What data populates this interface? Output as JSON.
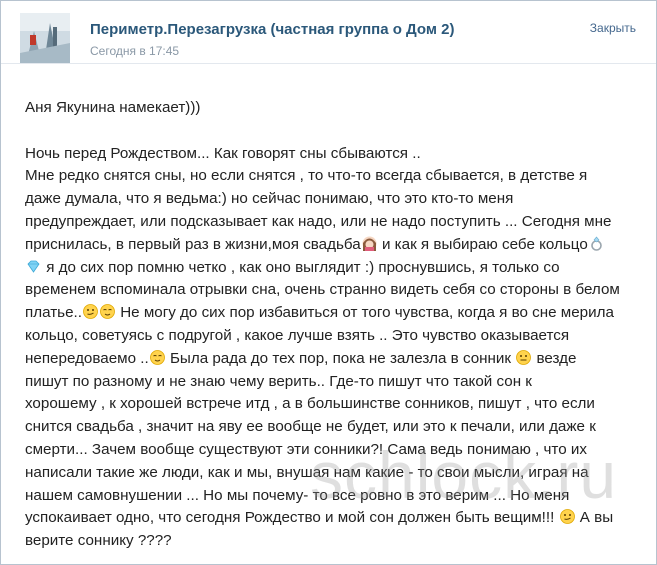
{
  "header": {
    "group_name": "Периметр.Перезагрузка (частная группа о Дом 2)",
    "post_time": "Сегодня в 17:45",
    "close_label": "Закрыть"
  },
  "post": {
    "intro": "Аня Якунина намекает)))",
    "lines": [
      "Ночь перед Рождеством... Как говорят сны сбываются ..",
      "Мне редко снятся сны, но если снятся , то что-то всегда сбывается, в детстве я",
      "даже думала, что я ведьма:) но сейчас понимаю, что это кто-то меня",
      "предупреждает, или подсказывает как надо, или не надо поступить ... Сегодня мне",
      "приснилась, в первый раз в жизни,моя свадьба",
      "и как я выбираю себе кольцо",
      "я до сих пор помню четко , как оно выглядит :) проснувшись, я только со",
      "временем вспоминала отрывки сна, очень странно видеть себя со стороны в белом",
      "платье..",
      "Не могу до сих пор избавиться от того чувства, когда я во сне мерила",
      "кольцо, советуясь с подругой , какое лучше взять .. Это чувство оказывается",
      "непередоваемо ..",
      "Была рада до тех пор, пока не залезла в сонник",
      "везде",
      "пишут по разному и не знаю чему верить.. Где-то пишут что такой сон к",
      "хорошему , к хорошей встрече итд , а в большинстве сонников, пишут , что если",
      "снится свадьба , значит на яву ее вообще не будет, или это к печали, или даже к",
      "смерти... Зачем вообще существуют эти сонники?! Сама ведь понимаю , что их",
      "написали такие же люди, как и мы, внушая нам какие - то свои мысли, играя на",
      "нашем самовнушении ... Но мы почему- то все ровно в это верим ... Но меня",
      "успокаивает одно, что сегодня Рождество и мой сон должен быть вещим!!!",
      "А вы",
      "верите соннику ????"
    ]
  },
  "watermark": "schlock.ru"
}
